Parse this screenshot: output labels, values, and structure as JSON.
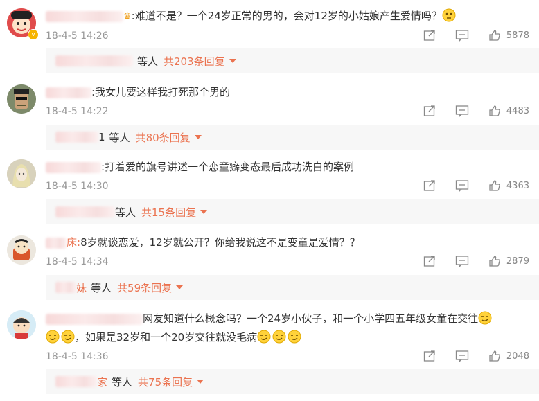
{
  "comments": [
    {
      "text": ":难道不是？一个24岁正常的男的，会对12岁的小姑娘产生爱情吗？",
      "time": "18-4-5 14:26",
      "likes": "5878",
      "replies_suffix": "等人",
      "replies_link": "共203条回复"
    },
    {
      "text": ":我女儿要这样我打死那个男的",
      "time": "18-4-5 14:22",
      "likes": "4483",
      "replies_prefix": "1",
      "replies_suffix": "等人",
      "replies_link": "共80条回复"
    },
    {
      "text": ":打着爱的旗号讲述一个恋童癖变态最后成功洗白的案例",
      "time": "18-4-5 14:30",
      "likes": "4363",
      "replies_suffix": "等人",
      "replies_link": "共15条回复"
    },
    {
      "text": "8岁就谈恋爱，12岁就公开？你给我说这不是变童是爱情？？",
      "name_tail": "床:",
      "time": "18-4-5 14:34",
      "likes": "2879",
      "replies_prefix": "妹",
      "replies_suffix": "等人",
      "replies_link": "共59条回复"
    },
    {
      "line1": "网友知道什么概念吗？一个24岁小伙子，和一个小学四五年级女童在交往",
      "line2": "，如果是32岁和一个20岁交往就没毛病",
      "time": "18-4-5 14:36",
      "likes": "2048",
      "replies_prefix": "家",
      "replies_suffix": "等人",
      "replies_link": "共75条回复"
    }
  ],
  "icons": {
    "share": "share-icon",
    "comment": "comment-icon",
    "like": "thumbs-up-icon",
    "dropdown": "caret-down-icon"
  },
  "colors": {
    "accent": "#eb7350",
    "meta": "#999999",
    "reply_bg": "#f7f7f7"
  }
}
